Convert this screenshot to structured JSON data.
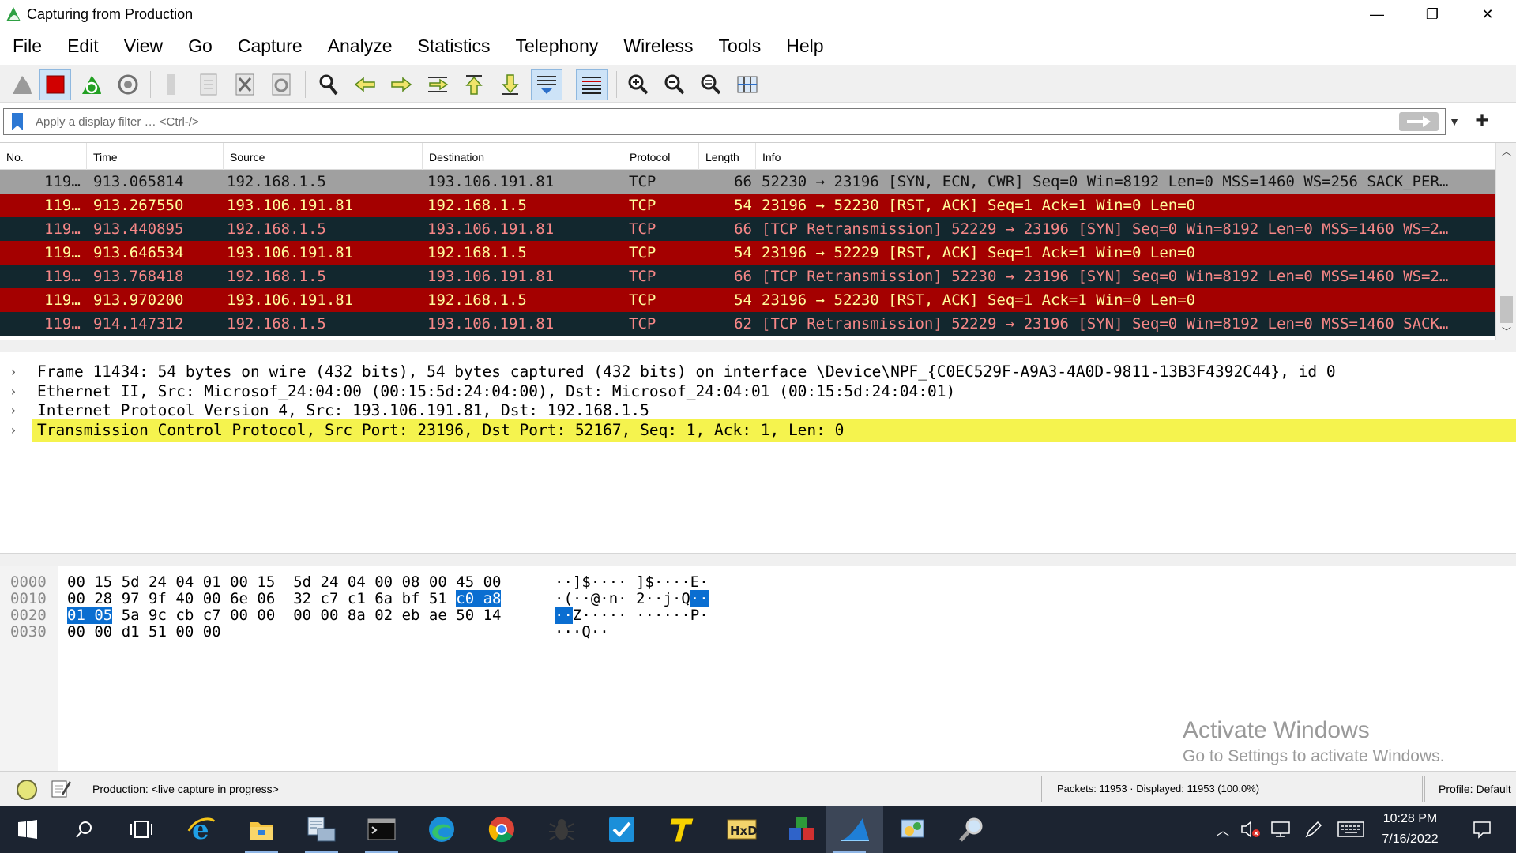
{
  "window": {
    "title": "Capturing from Production",
    "controls": {
      "minimize": "—",
      "restore": "❐",
      "close": "✕"
    }
  },
  "menu": [
    "File",
    "Edit",
    "View",
    "Go",
    "Capture",
    "Analyze",
    "Statistics",
    "Telephony",
    "Wireless",
    "Tools",
    "Help"
  ],
  "toolbar": {
    "buttons": [
      {
        "name": "start-capture-icon",
        "active": false
      },
      {
        "name": "stop-capture-icon",
        "active": true
      },
      {
        "name": "restart-capture-icon",
        "active": false
      },
      {
        "name": "capture-options-icon",
        "active": false
      },
      {
        "name": "open-file-icon",
        "active": false
      },
      {
        "name": "save-file-icon",
        "active": false
      },
      {
        "name": "close-file-icon",
        "active": false
      },
      {
        "name": "reload-file-icon",
        "active": false
      },
      {
        "name": "find-packet-icon",
        "active": false
      },
      {
        "name": "go-back-icon",
        "active": false
      },
      {
        "name": "go-forward-icon",
        "active": false
      },
      {
        "name": "go-to-packet-icon",
        "active": false
      },
      {
        "name": "first-packet-icon",
        "active": false
      },
      {
        "name": "last-packet-icon",
        "active": false
      },
      {
        "name": "autoscroll-icon",
        "active": true
      },
      {
        "name": "colorize-icon",
        "active": true
      },
      {
        "name": "zoom-in-icon",
        "active": false
      },
      {
        "name": "zoom-out-icon",
        "active": false
      },
      {
        "name": "zoom-normal-icon",
        "active": false
      },
      {
        "name": "resize-columns-icon",
        "active": false
      }
    ]
  },
  "filter": {
    "placeholder": "Apply a display filter … <Ctrl-/>",
    "value": ""
  },
  "packet_list": {
    "columns": [
      "No.",
      "Time",
      "Source",
      "Destination",
      "Protocol",
      "Length",
      "Info"
    ],
    "rows": [
      {
        "no": "119…",
        "time": "913.065814",
        "src": "192.168.1.5",
        "dst": "193.106.191.81",
        "proto": "TCP",
        "len": "66",
        "info": "52230 → 23196 [SYN, ECN, CWR] Seq=0 Win=8192 Len=0 MSS=1460 WS=256 SACK_PER…",
        "bg": "#a0a0a0",
        "fg": "#141414"
      },
      {
        "no": "119…",
        "time": "913.267550",
        "src": "193.106.191.81",
        "dst": "192.168.1.5",
        "proto": "TCP",
        "len": "54",
        "info": "23196 → 52230 [RST, ACK] Seq=1 Ack=1 Win=0 Len=0",
        "bg": "#a40000",
        "fg": "#fffc9c"
      },
      {
        "no": "119…",
        "time": "913.440895",
        "src": "192.168.1.5",
        "dst": "193.106.191.81",
        "proto": "TCP",
        "len": "66",
        "info": "[TCP Retransmission] 52229 → 23196 [SYN] Seq=0 Win=8192 Len=0 MSS=1460 WS=2…",
        "bg": "#12272e",
        "fg": "#f78787"
      },
      {
        "no": "119…",
        "time": "913.646534",
        "src": "193.106.191.81",
        "dst": "192.168.1.5",
        "proto": "TCP",
        "len": "54",
        "info": "23196 → 52229 [RST, ACK] Seq=1 Ack=1 Win=0 Len=0",
        "bg": "#a40000",
        "fg": "#fffc9c"
      },
      {
        "no": "119…",
        "time": "913.768418",
        "src": "192.168.1.5",
        "dst": "193.106.191.81",
        "proto": "TCP",
        "len": "66",
        "info": "[TCP Retransmission] 52230 → 23196 [SYN] Seq=0 Win=8192 Len=0 MSS=1460 WS=2…",
        "bg": "#12272e",
        "fg": "#f78787"
      },
      {
        "no": "119…",
        "time": "913.970200",
        "src": "193.106.191.81",
        "dst": "192.168.1.5",
        "proto": "TCP",
        "len": "54",
        "info": "23196 → 52230 [RST, ACK] Seq=1 Ack=1 Win=0 Len=0",
        "bg": "#a40000",
        "fg": "#fffc9c"
      },
      {
        "no": "119…",
        "time": "914.147312",
        "src": "192.168.1.5",
        "dst": "193.106.191.81",
        "proto": "TCP",
        "len": "62",
        "info": "[TCP Retransmission] 52229 → 23196 [SYN] Seq=0 Win=8192 Len=0 MSS=1460 SACK…",
        "bg": "#12272e",
        "fg": "#f78787"
      }
    ]
  },
  "details": [
    {
      "text": "Frame 11434: 54 bytes on wire (432 bits), 54 bytes captured (432 bits) on interface \\Device\\NPF_{C0EC529F-A9A3-4A0D-9811-13B3F4392C44}, id 0",
      "selected": false
    },
    {
      "text": "Ethernet II, Src: Microsof_24:04:00 (00:15:5d:24:04:00), Dst: Microsof_24:04:01 (00:15:5d:24:04:01)",
      "selected": false
    },
    {
      "text": "Internet Protocol Version 4, Src: 193.106.191.81, Dst: 192.168.1.5",
      "selected": false
    },
    {
      "text": "Transmission Control Protocol, Src Port: 23196, Dst Port: 52167, Seq: 1, Ack: 1, Len: 0",
      "selected": true
    }
  ],
  "bytes": [
    {
      "offset": "0000",
      "hex": [
        [
          "00",
          "15",
          "5d",
          "24",
          "04",
          "01",
          "00",
          "15"
        ],
        [
          "5d",
          "24",
          "04",
          "00",
          "08",
          "00",
          "45",
          "00"
        ]
      ],
      "ascii": [
        [
          "·",
          "·",
          "]",
          "$",
          "·",
          "·",
          "·",
          "·"
        ],
        [
          "]",
          "$",
          "·",
          "·",
          "·",
          "·",
          "E",
          "·"
        ]
      ]
    },
    {
      "offset": "0010",
      "hex": [
        [
          "00",
          "28",
          "97",
          "9f",
          "40",
          "00",
          "6e",
          "06"
        ],
        [
          "32",
          "c7",
          "c1",
          "6a",
          "bf",
          "51",
          "c0",
          "a8"
        ]
      ],
      "ascii": [
        [
          "·",
          "(",
          "·",
          "·",
          "@",
          "·",
          "n",
          "·"
        ],
        [
          "2",
          "·",
          "·",
          "j",
          "·",
          "Q",
          "·",
          "·"
        ]
      ],
      "hl_from": 14
    },
    {
      "offset": "0020",
      "hex": [
        [
          "01",
          "05",
          "5a",
          "9c",
          "cb",
          "c7",
          "00",
          "00"
        ],
        [
          "00",
          "00",
          "8a",
          "02",
          "eb",
          "ae",
          "50",
          "14"
        ]
      ],
      "ascii": [
        [
          "·",
          "·",
          "Z",
          "·",
          "·",
          "·",
          "·",
          "·"
        ],
        [
          "·",
          "·",
          "·",
          "·",
          "·",
          "·",
          "P",
          "·"
        ]
      ],
      "hl_to": 2
    },
    {
      "offset": "0030",
      "hex": [
        [
          "00",
          "00",
          "d1",
          "51",
          "00",
          "00"
        ],
        []
      ],
      "ascii": [
        [
          "·",
          "·",
          "·",
          "Q",
          "·",
          "·"
        ],
        []
      ]
    }
  ],
  "watermark": {
    "title": "Activate Windows",
    "subtitle": "Go to Settings to activate Windows."
  },
  "status": {
    "capture": "Production: <live capture in progress>",
    "packets": "Packets: 11953 · Displayed: 11953 (100.0%)",
    "profile": "Profile: Default"
  },
  "taskbar": {
    "apps": [
      "start-icon",
      "search-icon",
      "task-view-icon",
      "internet-explorer-icon",
      "file-explorer-icon",
      "network-tool-icon",
      "terminal-icon",
      "edge-icon",
      "chrome-icon",
      "bug-tool-icon",
      "task-checker-icon",
      "text-editor-icon",
      "hxd-icon",
      "cubes-app-icon",
      "wireshark-icon",
      "control-panel-icon",
      "magnifier-tool-icon"
    ],
    "time": "10:28 PM",
    "date": "7/16/2022"
  }
}
